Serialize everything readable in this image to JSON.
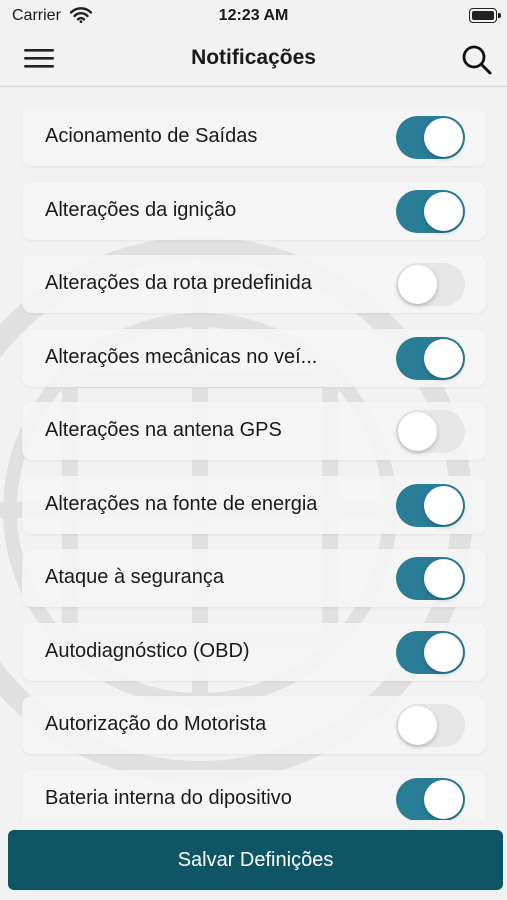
{
  "status_bar": {
    "carrier": "Carrier",
    "time": "12:23 AM"
  },
  "header": {
    "title": "Notificações",
    "menu_icon": "hamburger-menu-icon",
    "search_icon": "search-icon"
  },
  "colors": {
    "accent": "#2a7d96",
    "button": "#0e5566",
    "toggle_off": "#e6e6e6"
  },
  "notifications": [
    {
      "label": "Acionamento de Saídas",
      "enabled": true
    },
    {
      "label": "Alterações da ignição",
      "enabled": true
    },
    {
      "label": "Alterações da rota predefinida",
      "enabled": false
    },
    {
      "label": "Alterações mecânicas no veí...",
      "enabled": true
    },
    {
      "label": "Alterações na antena GPS",
      "enabled": false
    },
    {
      "label": "Alterações na fonte de energia",
      "enabled": true
    },
    {
      "label": "Ataque à segurança",
      "enabled": true
    },
    {
      "label": "Autodiagnóstico (OBD)",
      "enabled": true
    },
    {
      "label": "Autorização do Motorista",
      "enabled": false
    },
    {
      "label": "Bateria interna do dipositivo",
      "enabled": true
    }
  ],
  "footer": {
    "save_label": "Salvar Definições"
  }
}
